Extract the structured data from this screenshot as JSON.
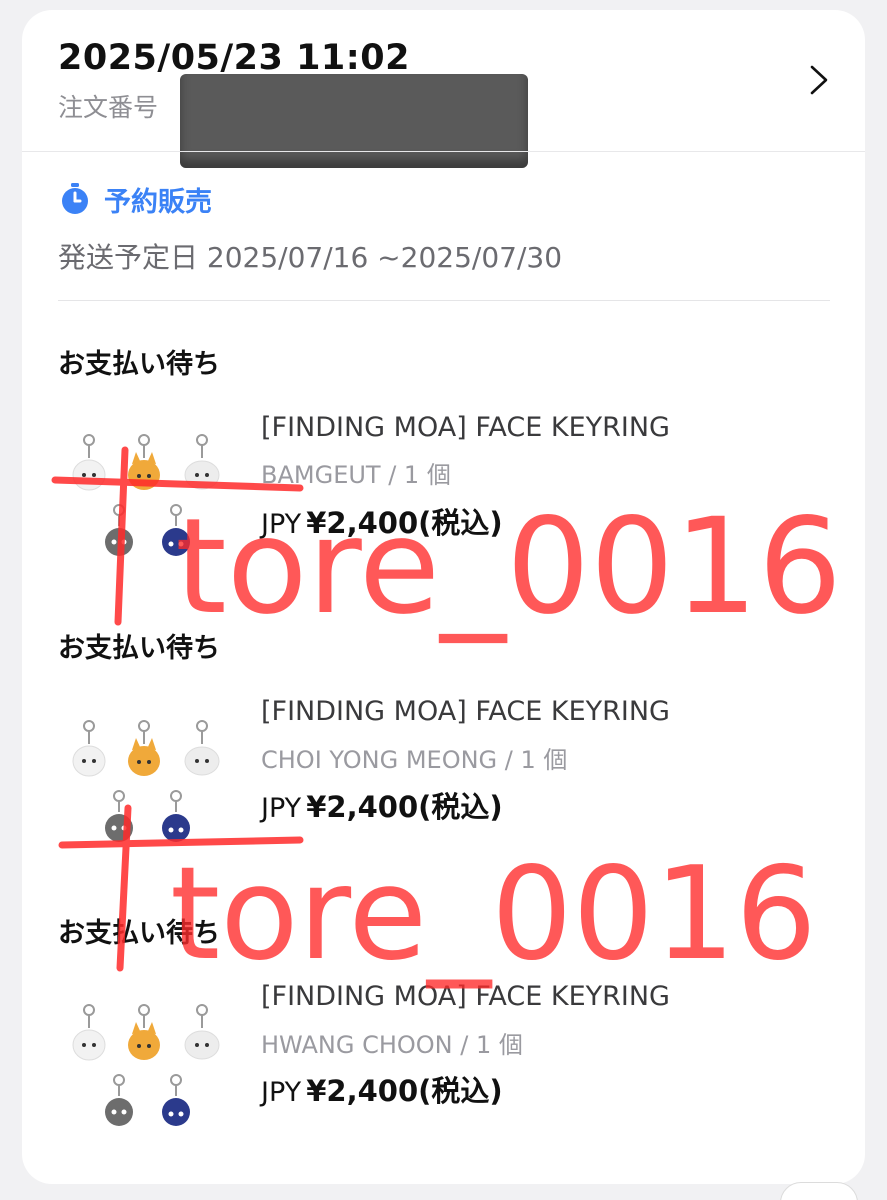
{
  "order": {
    "datetime": "2025/05/23 11:02",
    "number_label": "注文番号"
  },
  "preorder": {
    "label": "予約販売",
    "ship_date": "発送予定日 2025/07/16 ~2025/07/30",
    "icon": "stopwatch-icon",
    "accent": "#3b82f6"
  },
  "items": [
    {
      "status": "お支払い待ち",
      "title": "[FINDING MOA] FACE KEYRING",
      "variant": "BAMGEUT / 1 個",
      "currency": "JPY",
      "price": "¥2,400(税込)"
    },
    {
      "status": "お支払い待ち",
      "title": "[FINDING MOA] FACE KEYRING",
      "variant": "CHOI YONG MEONG / 1 個",
      "currency": "JPY",
      "price": "¥2,400(税込)"
    },
    {
      "status": "お支払い待ち",
      "title": "[FINDING MOA] FACE KEYRING",
      "variant": "HWANG CHOON / 1 個",
      "currency": "JPY",
      "price": "¥2,400(税込)"
    }
  ],
  "watermark": {
    "text": "tore_0016",
    "color": "#ff2a2a"
  }
}
